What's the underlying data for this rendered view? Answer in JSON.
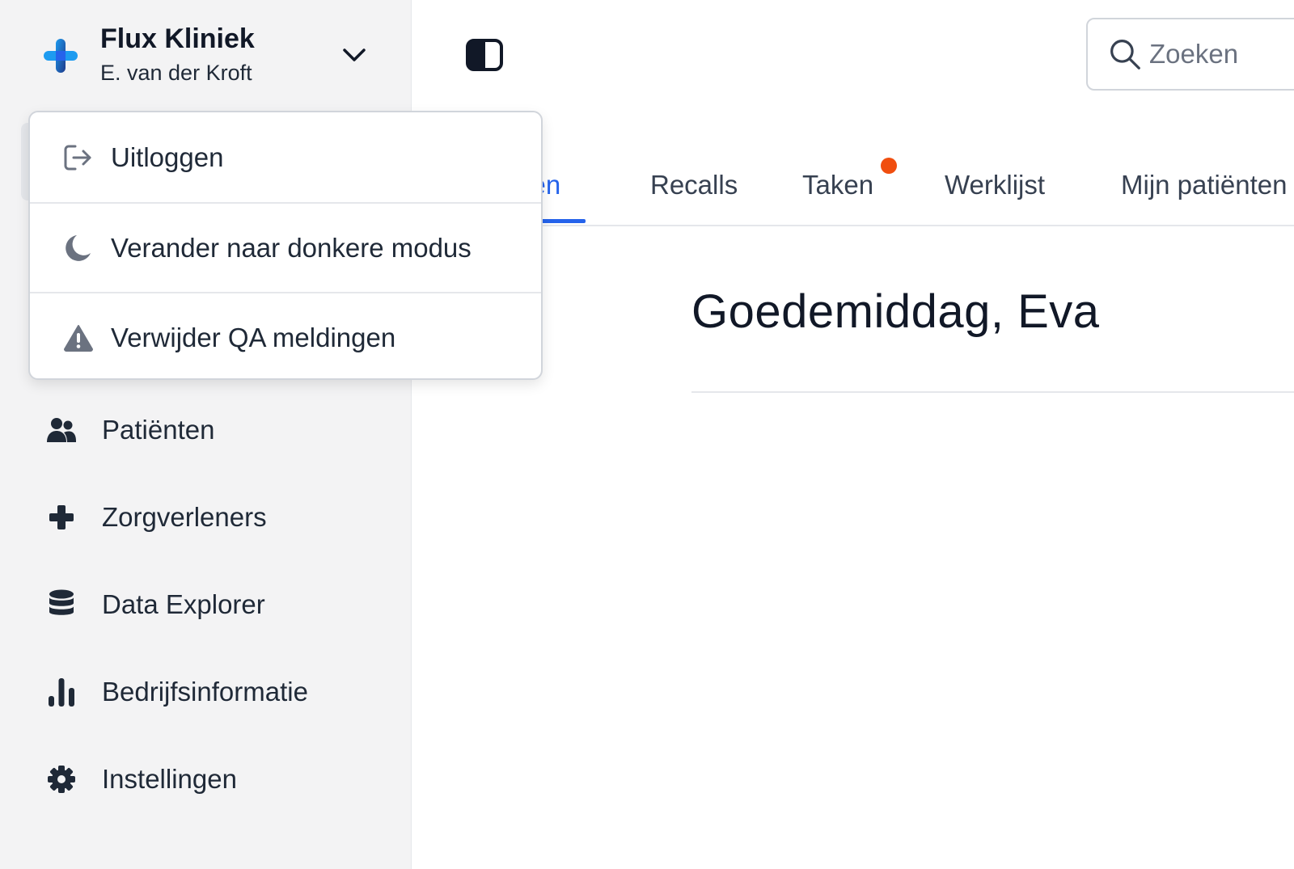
{
  "brand": {
    "name": "Flux Kliniek",
    "user": "E. van der Kroft"
  },
  "user_menu": {
    "items": [
      {
        "label": "Uitloggen",
        "icon": "logout-icon"
      },
      {
        "label": "Verander naar donkere modus",
        "icon": "moon-icon"
      },
      {
        "label": "Verwijder QA meldingen",
        "icon": "warning-icon"
      }
    ]
  },
  "sidebar": {
    "items": [
      {
        "label": "Patiënten",
        "icon": "users-icon"
      },
      {
        "label": "Zorgverleners",
        "icon": "plus-icon"
      },
      {
        "label": "Data Explorer",
        "icon": "database-icon"
      },
      {
        "label": "Bedrijfsinformatie",
        "icon": "bar-chart-icon"
      },
      {
        "label": "Instellingen",
        "icon": "gear-icon"
      }
    ]
  },
  "search": {
    "placeholder": "Zoeken"
  },
  "tabs": [
    {
      "label": "ken",
      "active": true
    },
    {
      "label": "Recalls",
      "active": false
    },
    {
      "label": "Taken",
      "active": false,
      "has_notification": true
    },
    {
      "label": "Werklijst",
      "active": false
    },
    {
      "label": "Mijn patiënten",
      "active": false
    }
  ],
  "main": {
    "greeting": "Goedemiddag, Eva"
  },
  "colors": {
    "accent": "#2563eb",
    "notification": "#f04e0f",
    "sidebar_bg": "#f3f3f4"
  }
}
